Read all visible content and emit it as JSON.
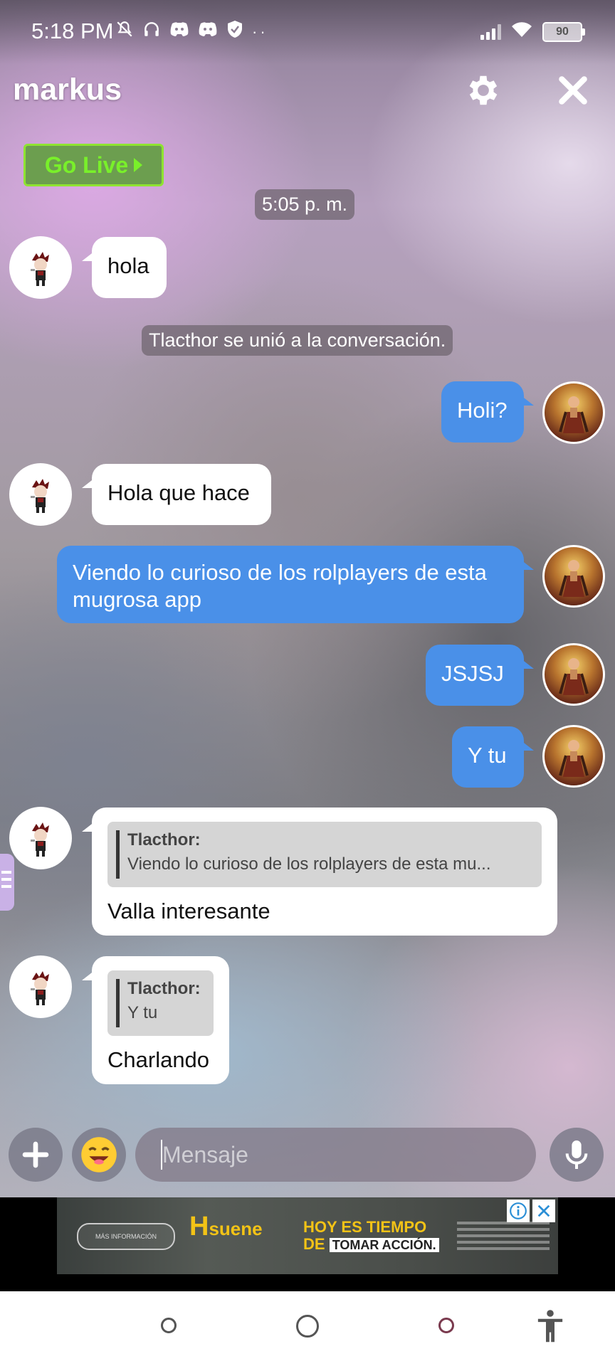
{
  "status_bar": {
    "time": "5:18 PM",
    "battery": "90",
    "left_icons": [
      "mute-icon",
      "headphones-icon",
      "discord-icon",
      "discord-icon",
      "shield-icon",
      "more-dots-icon"
    ],
    "right_icons": [
      "signal-icon",
      "wifi-icon",
      "battery-icon"
    ]
  },
  "header": {
    "title": "markus",
    "settings_icon": "gear-icon",
    "close_icon": "close-icon"
  },
  "go_live": {
    "label": "Go Live"
  },
  "chat": {
    "timestamp": "5:05 p. m.",
    "system_join": "Tlacthor se unió a la conversación.",
    "messages": [
      {
        "side": "in",
        "text": "hola"
      },
      {
        "side": "out",
        "text": "Holi?"
      },
      {
        "side": "in",
        "text": "Hola que hace"
      },
      {
        "side": "out",
        "text_line1": "Viendo lo curioso de los rolplayers de esta",
        "text_line2": "mugrosa app"
      },
      {
        "side": "out",
        "text": "JSJSJ"
      },
      {
        "side": "out",
        "text": "Y tu"
      },
      {
        "side": "in",
        "quote_author": "Tlacthor:",
        "quote_text": "Viendo lo curioso de los rolplayers de esta mu...",
        "text": "Valla interesante"
      },
      {
        "side": "in",
        "quote_author": "Tlacthor:",
        "quote_text": "Y tu",
        "text": "Charlando"
      }
    ]
  },
  "composer": {
    "placeholder": "Mensaje",
    "plus_icon": "plus-icon",
    "emoji_icon": "smiley-emoji-icon",
    "mic_icon": "microphone-icon"
  },
  "ad": {
    "pill_text": "MÁS INFORMACIÓN",
    "h_letter": "H",
    "h_word": "suene",
    "hoy_line1": "HOY ES TIEMPO",
    "hoy_de": "DE",
    "hoy_box": "TOMAR ACCIÓN."
  },
  "colors": {
    "accent_blue": "#4a90e8",
    "go_live_green": "#79f02a"
  }
}
